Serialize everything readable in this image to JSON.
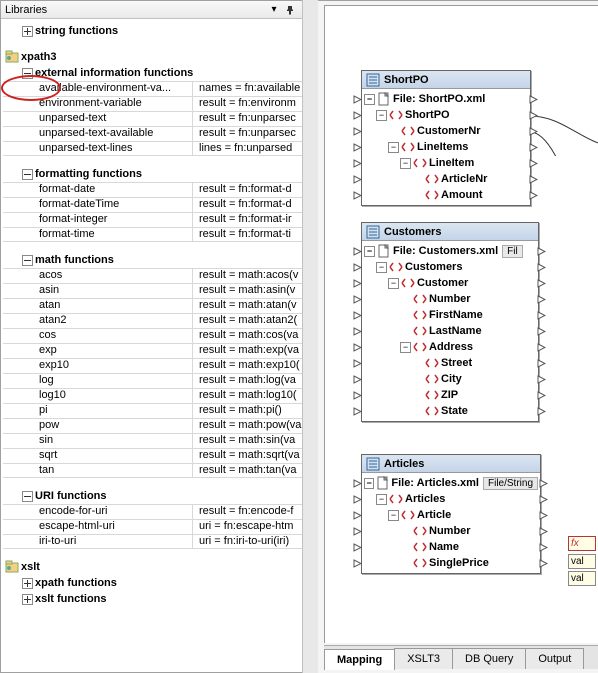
{
  "panel": {
    "title": "Libraries",
    "tree": {
      "string_functions": {
        "label": "string functions"
      },
      "xpath3": {
        "label": "xpath3"
      },
      "ext_info": {
        "label": "external information functions",
        "rows": [
          {
            "name": "available-environment-va...",
            "result": "names = fn:available"
          },
          {
            "name": "environment-variable",
            "result": "result = fn:environm"
          },
          {
            "name": "unparsed-text",
            "result": "result = fn:unparsec"
          },
          {
            "name": "unparsed-text-available",
            "result": "result = fn:unparsec"
          },
          {
            "name": "unparsed-text-lines",
            "result": "lines = fn:unparsed"
          }
        ]
      },
      "formatting": {
        "label": "formatting functions",
        "rows": [
          {
            "name": "format-date",
            "result": "result = fn:format-d"
          },
          {
            "name": "format-dateTime",
            "result": "result = fn:format-d"
          },
          {
            "name": "format-integer",
            "result": "result = fn:format-ir"
          },
          {
            "name": "format-time",
            "result": "result = fn:format-ti"
          }
        ]
      },
      "math": {
        "label": "math functions",
        "rows": [
          {
            "name": "acos",
            "result": "result = math:acos(v"
          },
          {
            "name": "asin",
            "result": "result = math:asin(v"
          },
          {
            "name": "atan",
            "result": "result = math:atan(v"
          },
          {
            "name": "atan2",
            "result": "result = math:atan2("
          },
          {
            "name": "cos",
            "result": "result = math:cos(va"
          },
          {
            "name": "exp",
            "result": "result = math:exp(va"
          },
          {
            "name": "exp10",
            "result": "result = math:exp10("
          },
          {
            "name": "log",
            "result": "result = math:log(va"
          },
          {
            "name": "log10",
            "result": "result = math:log10("
          },
          {
            "name": "pi",
            "result": "result = math:pi()"
          },
          {
            "name": "pow",
            "result": "result = math:pow(va"
          },
          {
            "name": "sin",
            "result": "result = math:sin(va"
          },
          {
            "name": "sqrt",
            "result": "result = math:sqrt(va"
          },
          {
            "name": "tan",
            "result": "result = math:tan(va"
          }
        ]
      },
      "uri": {
        "label": "URI functions",
        "rows": [
          {
            "name": "encode-for-uri",
            "result": "result = fn:encode-f"
          },
          {
            "name": "escape-html-uri",
            "result": "uri = fn:escape-htm"
          },
          {
            "name": "iri-to-uri",
            "result": "uri = fn:iri-to-uri(iri)"
          }
        ]
      },
      "xslt": {
        "label": "xslt"
      },
      "xpath_funcs": {
        "label": "xpath functions"
      },
      "xslt_funcs": {
        "label": "xslt functions"
      }
    }
  },
  "canvas": {
    "shortpo": {
      "title": "ShortPO",
      "file": "File: ShortPO.xml",
      "nodes": [
        "ShortPO",
        "CustomerNr",
        "LineItems",
        "LineItem",
        "ArticleNr",
        "Amount"
      ]
    },
    "customers": {
      "title": "Customers",
      "file": "File: Customers.xml",
      "file_chip": "Fil",
      "nodes": [
        "Customers",
        "Customer",
        "Number",
        "FirstName",
        "LastName",
        "Address",
        "Street",
        "City",
        "ZIP",
        "State"
      ]
    },
    "articles": {
      "title": "Articles",
      "file": "File: Articles.xml",
      "file_chip": "File/String",
      "nodes": [
        "Articles",
        "Article",
        "Number",
        "Name",
        "SinglePrice"
      ]
    },
    "mini": {
      "fx": "fx",
      "val1": "val",
      "val2": "val"
    }
  },
  "tabs": {
    "items": [
      "Mapping",
      "XSLT3",
      "DB Query",
      "Output"
    ],
    "active": 0
  }
}
